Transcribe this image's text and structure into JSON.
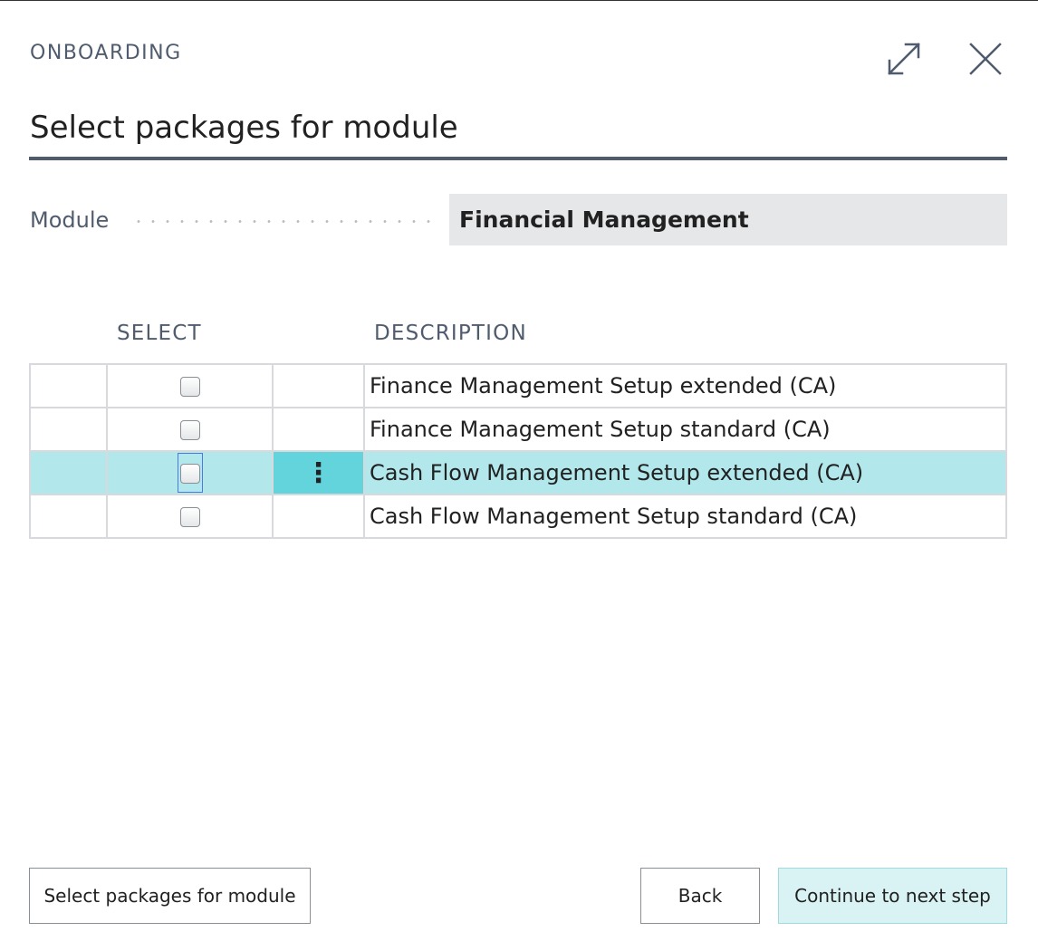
{
  "dialog": {
    "caption": "ONBOARDING",
    "title": "Select packages for module"
  },
  "icons": {
    "expand": "expand-icon",
    "close": "close-icon"
  },
  "module_field": {
    "label": "Module",
    "value": "Financial Management"
  },
  "table": {
    "headers": {
      "select": "SELECT",
      "description": "DESCRIPTION"
    },
    "rows": [
      {
        "select": false,
        "description": "Finance Management Setup extended (CA)",
        "selected": false
      },
      {
        "select": false,
        "description": "Finance Management Setup standard (CA)",
        "selected": false
      },
      {
        "select": false,
        "description": "Cash Flow Management Setup extended (CA)",
        "selected": true
      },
      {
        "select": false,
        "description": "Cash Flow Management Setup standard (CA)",
        "selected": false
      }
    ],
    "row_menu_glyph": "⋮"
  },
  "footer": {
    "module_button": "Select packages for module",
    "back_button": "Back",
    "next_button": "Continue to next step"
  },
  "colors": {
    "caption": "#505c6d",
    "selected_row": "#b2e8ec",
    "selected_menu_cell": "#63d3dc",
    "primary_button": "#d9f3f5",
    "field_background": "#e6e7e9"
  }
}
